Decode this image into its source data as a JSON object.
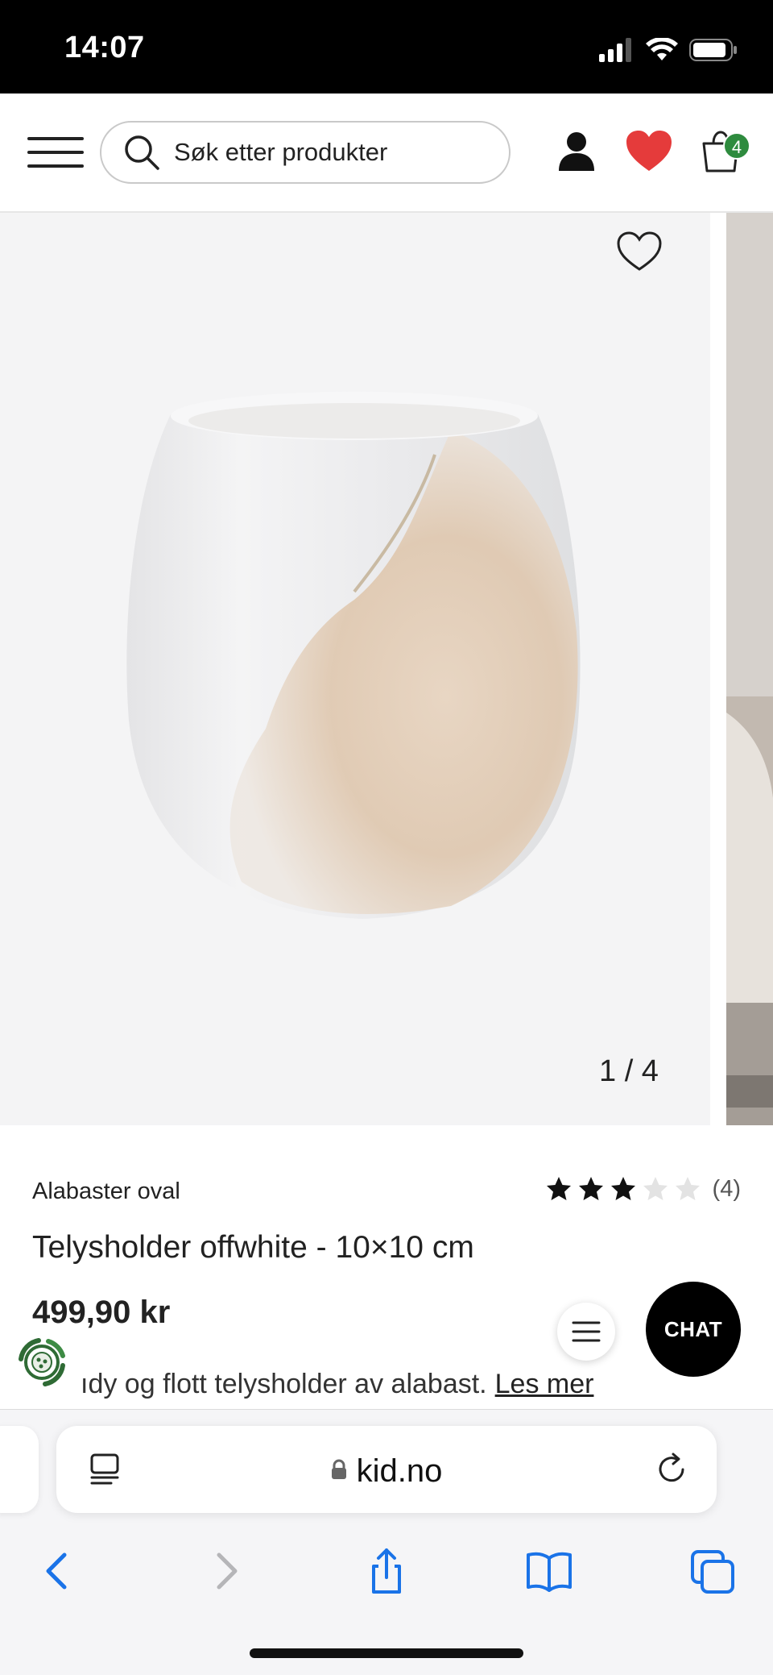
{
  "status_bar": {
    "time": "14:07"
  },
  "header": {
    "search_placeholder": "Søk etter produkter",
    "cart_count": "4",
    "colors": {
      "heart": "#e53b3b",
      "badge": "#2e8b3e"
    }
  },
  "gallery": {
    "counter": "1 / 4"
  },
  "product": {
    "brand": "Alabaster oval",
    "rating": 3,
    "rating_max": 5,
    "rating_count": "(4)",
    "title": "Telysholder offwhite - 10×10 cm",
    "price": "499,90 kr",
    "description": "ıdy og flott telysholder av alabast.",
    "read_more": "Les mer"
  },
  "fabs": {
    "chat_label": "CHAT"
  },
  "browser": {
    "url": "kid.no"
  },
  "icons": [
    "menu-icon",
    "search-icon",
    "user-icon",
    "heart-icon",
    "cart-icon",
    "favorite-icon",
    "star-icon",
    "list-icon",
    "eco-icon",
    "tabs-icon",
    "lock-icon",
    "reload-icon",
    "back-icon",
    "forward-icon",
    "share-icon",
    "bookmarks-icon",
    "tab-switcher-icon"
  ]
}
